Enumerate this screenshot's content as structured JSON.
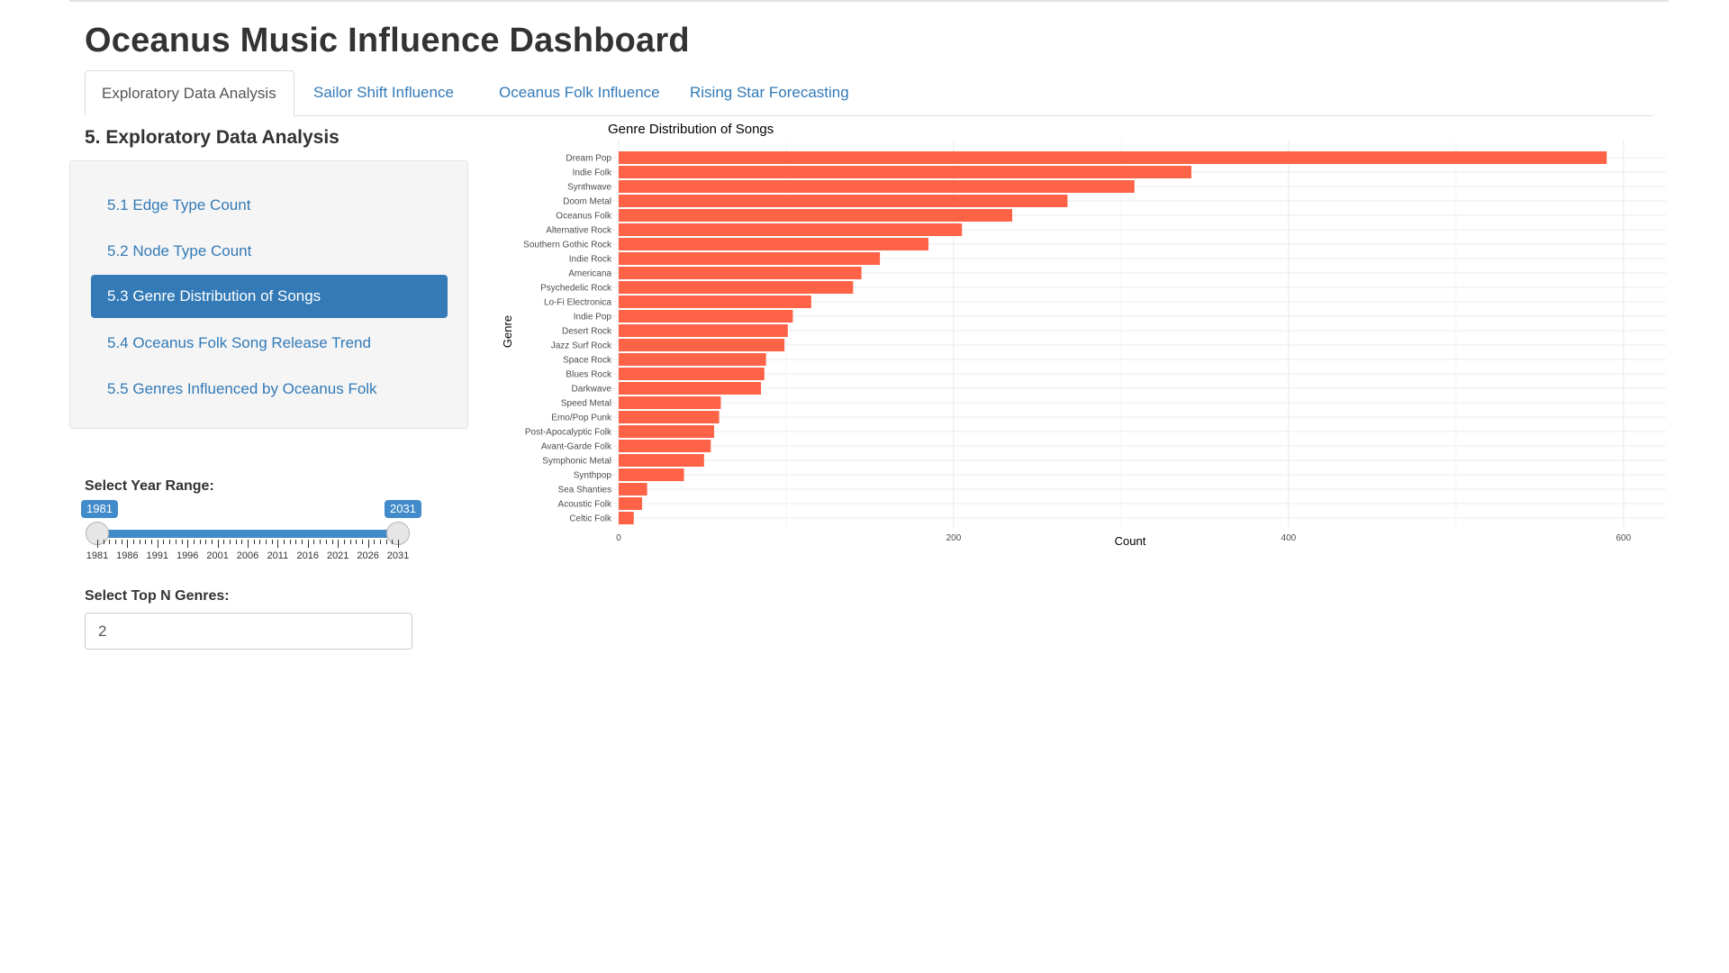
{
  "app_title": "Oceanus Music Influence Dashboard",
  "tabs": [
    {
      "label": "Exploratory Data Analysis",
      "active": true
    },
    {
      "label": "Sailor Shift Influence",
      "active": false
    },
    {
      "label": "Oceanus Folk Influence",
      "active": false
    },
    {
      "label": "Rising Star Forecasting",
      "active": false
    }
  ],
  "section_title": "5. Exploratory Data Analysis",
  "nav_items": [
    {
      "label": "5.1 Edge Type Count",
      "active": false
    },
    {
      "label": "5.2 Node Type Count",
      "active": false
    },
    {
      "label": "5.3 Genre Distribution of Songs",
      "active": true
    },
    {
      "label": "5.4 Oceanus Folk Song Release Trend",
      "active": false
    },
    {
      "label": "5.5 Genres Influenced by Oceanus Folk",
      "active": false
    }
  ],
  "year_range": {
    "label": "Select Year Range:",
    "min": 1981,
    "max": 2031,
    "from": "1981",
    "to": "2031",
    "tick_labels": [
      "1981",
      "1986",
      "1991",
      "1996",
      "2001",
      "2006",
      "2011",
      "2016",
      "2021",
      "2026",
      "2031"
    ]
  },
  "top_n": {
    "label": "Select Top N Genres:",
    "value": "2"
  },
  "colors": {
    "accent": "#337ab7",
    "bar": "#FF6347",
    "slider": "#428bca"
  },
  "chart_data": {
    "type": "bar",
    "orientation": "horizontal",
    "title": "Genre Distribution of Songs",
    "xlabel": "Count",
    "ylabel": "Genre",
    "xlim": [
      0,
      620
    ],
    "x_ticks": [
      0,
      200,
      400,
      600
    ],
    "grid": true,
    "categories": [
      "Dream Pop",
      "Indie Folk",
      "Synthwave",
      "Doom Metal",
      "Oceanus Folk",
      "Alternative Rock",
      "Southern Gothic Rock",
      "Indie Rock",
      "Americana",
      "Psychedelic Rock",
      "Lo-Fi Electronica",
      "Indie Pop",
      "Desert Rock",
      "Jazz Surf Rock",
      "Space Rock",
      "Blues Rock",
      "Darkwave",
      "Speed Metal",
      "Emo/Pop Punk",
      "Post-Apocalyptic Folk",
      "Avant-Garde Folk",
      "Symphonic Metal",
      "Synthpop",
      "Sea Shanties",
      "Acoustic Folk",
      "Celtic Folk"
    ],
    "values": [
      590,
      342,
      308,
      268,
      235,
      205,
      185,
      156,
      145,
      140,
      115,
      104,
      101,
      99,
      88,
      87,
      85,
      61,
      60,
      57,
      55,
      51,
      39,
      17,
      14,
      9
    ]
  }
}
